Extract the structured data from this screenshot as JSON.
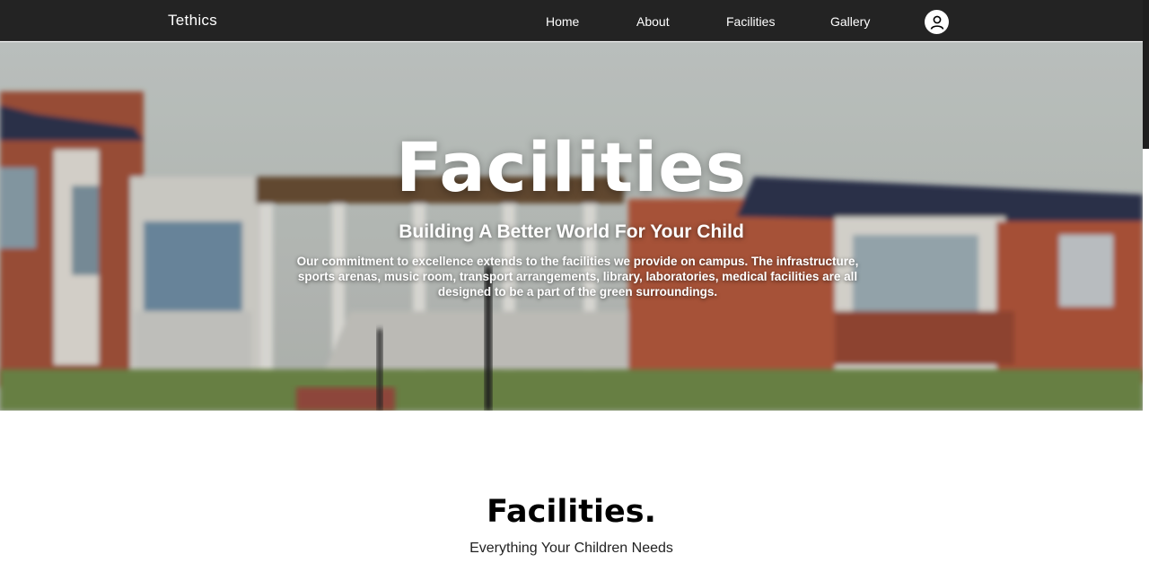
{
  "nav": {
    "brand": "Tethics",
    "links": [
      "Home",
      "About",
      "Facilities",
      "Gallery"
    ],
    "profile_icon": "user-icon"
  },
  "hero": {
    "title": "Facilities",
    "subtitle": "Building A Better World For Your Child",
    "description": "Our commitment to excellence extends to the facilities we provide on campus. The infrastructure, sports arenas, music room, transport arrangements, library, laboratories, medical facilities are all designed to be a part of the green surroundings."
  },
  "section": {
    "title": "Facilities.",
    "subtitle": "Everything Your Children Needs"
  },
  "colors": {
    "navbar": "#232323",
    "text_light": "#ffffff",
    "text_dark": "#000000"
  }
}
